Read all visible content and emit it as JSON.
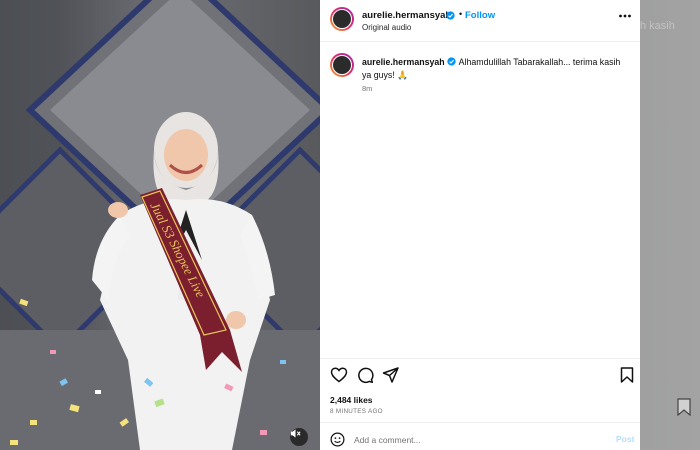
{
  "post": {
    "username": "aurelie.hermansyah",
    "follow_label": "Follow",
    "audio_label": "Original audio",
    "caption_username": "aurelie.hermansyah",
    "caption_text": "Alhamdulillah Tabarakallah... terima kasih ya guys! 🙏",
    "caption_time": "8m",
    "likes": "2,484 likes",
    "posted_ago": "8 MINUTES AGO",
    "comment_placeholder": "Add a comment...",
    "post_label": "Post"
  },
  "media": {
    "sash_text": "Jual S3 Shopee Live"
  },
  "backdrop": {
    "ghost_text": "h kasih"
  },
  "colors": {
    "accent": "#0095f6",
    "verified": "#0095f6",
    "sash": "#7b1f2e",
    "sash_text": "#e8c35a"
  },
  "icons": [
    "more-options-icon",
    "heart-icon",
    "comment-icon",
    "share-icon",
    "bookmark-icon",
    "emoji-icon",
    "mute-icon",
    "verified-badge-icon"
  ]
}
